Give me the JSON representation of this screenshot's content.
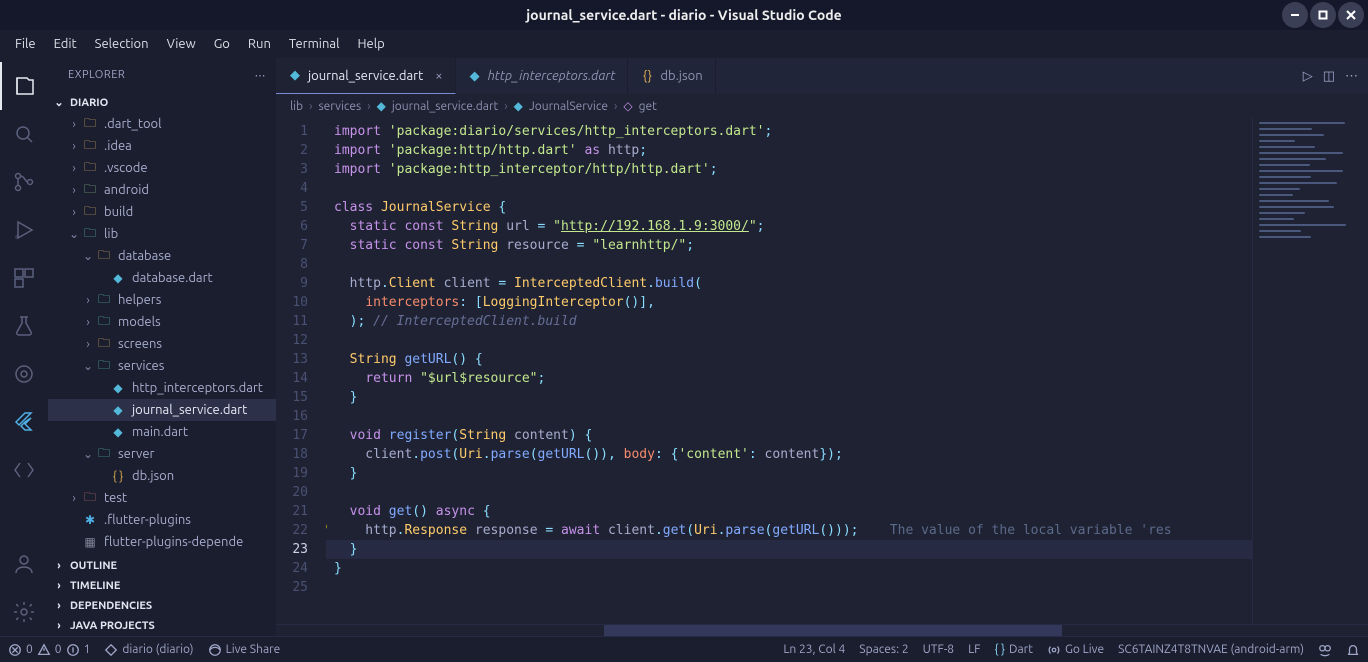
{
  "window": {
    "title": "journal_service.dart - diario - Visual Studio Code"
  },
  "menu": [
    "File",
    "Edit",
    "Selection",
    "View",
    "Go",
    "Run",
    "Terminal",
    "Help"
  ],
  "sidebar": {
    "header": "EXPLORER",
    "project": "DIARIO",
    "tree": [
      {
        "depth": 1,
        "exp": "›",
        "icon": "folder",
        "label": ".dart_tool"
      },
      {
        "depth": 1,
        "exp": "›",
        "icon": "folder",
        "label": ".idea"
      },
      {
        "depth": 1,
        "exp": "›",
        "icon": "folder",
        "label": ".vscode"
      },
      {
        "depth": 1,
        "exp": "›",
        "icon": "folder green",
        "label": "android"
      },
      {
        "depth": 1,
        "exp": "›",
        "icon": "folder",
        "label": "build"
      },
      {
        "depth": 1,
        "exp": "⌄",
        "icon": "folder teal",
        "label": "lib"
      },
      {
        "depth": 2,
        "exp": "⌄",
        "icon": "folder",
        "label": "database"
      },
      {
        "depth": 3,
        "exp": " ",
        "icon": "dart",
        "label": "database.dart"
      },
      {
        "depth": 2,
        "exp": "›",
        "icon": "folder teal",
        "label": "helpers"
      },
      {
        "depth": 2,
        "exp": "›",
        "icon": "folder teal",
        "label": "models"
      },
      {
        "depth": 2,
        "exp": "›",
        "icon": "folder",
        "label": "screens"
      },
      {
        "depth": 2,
        "exp": "⌄",
        "icon": "folder teal",
        "label": "services"
      },
      {
        "depth": 3,
        "exp": " ",
        "icon": "dart",
        "label": "http_interceptors.dart"
      },
      {
        "depth": 3,
        "exp": " ",
        "icon": "dart",
        "label": "journal_service.dart",
        "selected": true
      },
      {
        "depth": 3,
        "exp": " ",
        "icon": "dart",
        "label": "main.dart"
      },
      {
        "depth": 2,
        "exp": "⌄",
        "icon": "folder teal",
        "label": "server"
      },
      {
        "depth": 3,
        "exp": " ",
        "icon": "json",
        "label": "db.json"
      },
      {
        "depth": 1,
        "exp": "›",
        "icon": "folder red",
        "label": "test"
      },
      {
        "depth": 1,
        "exp": " ",
        "icon": "flutter",
        "label": ".flutter-plugins"
      },
      {
        "depth": 1,
        "exp": " ",
        "icon": "misc",
        "label": "flutter-plugins-depende"
      }
    ],
    "sections": [
      {
        "label": "OUTLINE",
        "open": false
      },
      {
        "label": "TIMELINE",
        "open": false
      },
      {
        "label": "DEPENDENCIES",
        "open": false
      },
      {
        "label": "JAVA PROJECTS",
        "open": false
      }
    ]
  },
  "tabs": [
    {
      "icon": "dart",
      "label": "journal_service.dart",
      "active": true,
      "close": true
    },
    {
      "icon": "dart",
      "label": "http_interceptors.dart",
      "italic": true
    },
    {
      "icon": "json",
      "label": "db.json"
    }
  ],
  "breadcrumbs": [
    "lib",
    "services",
    "journal_service.dart",
    "JournalService",
    "get"
  ],
  "code": {
    "numbers": 25,
    "active_line": 23,
    "bulb_line": 22,
    "lines": [
      [
        [
          "c-key",
          "import "
        ],
        [
          "c-str",
          "'package:diario/services/http_interceptors.dart'"
        ],
        [
          "c-punc",
          ";"
        ]
      ],
      [
        [
          "c-key",
          "import "
        ],
        [
          "c-str",
          "'package:http/http.dart'"
        ],
        [
          "c-key",
          " as "
        ],
        [
          "c-ident",
          "http"
        ],
        [
          "c-punc",
          ";"
        ]
      ],
      [
        [
          "c-key",
          "import "
        ],
        [
          "c-str",
          "'package:http_interceptor/http/http.dart'"
        ],
        [
          "c-punc",
          ";"
        ]
      ],
      [],
      [
        [
          "c-key",
          "class "
        ],
        [
          "c-type",
          "JournalService "
        ],
        [
          "c-punc",
          "{"
        ]
      ],
      [
        [
          "c-ident",
          "  "
        ],
        [
          "c-key",
          "static const "
        ],
        [
          "c-type",
          "String "
        ],
        [
          "c-ident",
          "url "
        ],
        [
          "c-punc",
          "= "
        ],
        [
          "c-str",
          "\""
        ],
        [
          "c-link",
          "http://192.168.1.9:3000/"
        ],
        [
          "c-str",
          "\""
        ],
        [
          "c-punc",
          ";"
        ]
      ],
      [
        [
          "c-ident",
          "  "
        ],
        [
          "c-key",
          "static const "
        ],
        [
          "c-type",
          "String "
        ],
        [
          "c-ident",
          "resource "
        ],
        [
          "c-punc",
          "= "
        ],
        [
          "c-str",
          "\"learnhttp/\""
        ],
        [
          "c-punc",
          ";"
        ]
      ],
      [],
      [
        [
          "c-ident",
          "  http"
        ],
        [
          "c-punc",
          "."
        ],
        [
          "c-type",
          "Client "
        ],
        [
          "c-ident",
          "client "
        ],
        [
          "c-punc",
          "= "
        ],
        [
          "c-type",
          "InterceptedClient"
        ],
        [
          "c-punc",
          "."
        ],
        [
          "c-func",
          "build"
        ],
        [
          "c-punc",
          "("
        ]
      ],
      [
        [
          "c-ident",
          "    "
        ],
        [
          "c-param",
          "interceptors"
        ],
        [
          "c-punc",
          ": ["
        ],
        [
          "c-type",
          "LoggingInterceptor"
        ],
        [
          "c-punc",
          "()],"
        ]
      ],
      [
        [
          "c-ident",
          "  "
        ],
        [
          "c-punc",
          "); "
        ],
        [
          "c-comm",
          "// InterceptedClient.build"
        ]
      ],
      [],
      [
        [
          "c-ident",
          "  "
        ],
        [
          "c-type",
          "String "
        ],
        [
          "c-func",
          "getURL"
        ],
        [
          "c-punc",
          "() {"
        ]
      ],
      [
        [
          "c-ident",
          "    "
        ],
        [
          "c-key",
          "return "
        ],
        [
          "c-str",
          "\"$url$resource\""
        ],
        [
          "c-punc",
          ";"
        ]
      ],
      [
        [
          "c-ident",
          "  "
        ],
        [
          "c-punc",
          "}"
        ]
      ],
      [],
      [
        [
          "c-ident",
          "  "
        ],
        [
          "c-key",
          "void "
        ],
        [
          "c-func",
          "register"
        ],
        [
          "c-punc",
          "("
        ],
        [
          "c-type",
          "String "
        ],
        [
          "c-ident",
          "content"
        ],
        [
          "c-punc",
          ") {"
        ]
      ],
      [
        [
          "c-ident",
          "    client"
        ],
        [
          "c-punc",
          "."
        ],
        [
          "c-func",
          "post"
        ],
        [
          "c-punc",
          "("
        ],
        [
          "c-type",
          "Uri"
        ],
        [
          "c-punc",
          "."
        ],
        [
          "c-func",
          "parse"
        ],
        [
          "c-punc",
          "("
        ],
        [
          "c-func",
          "getURL"
        ],
        [
          "c-punc",
          "())"
        ],
        [
          "c-punc",
          ", "
        ],
        [
          "c-param",
          "body"
        ],
        [
          "c-punc",
          ": {"
        ],
        [
          "c-str",
          "'content'"
        ],
        [
          "c-punc",
          ": "
        ],
        [
          "c-ident",
          "content"
        ],
        [
          "c-punc",
          "});"
        ]
      ],
      [
        [
          "c-ident",
          "  "
        ],
        [
          "c-punc",
          "}"
        ]
      ],
      [],
      [
        [
          "c-ident",
          "  "
        ],
        [
          "c-key",
          "void "
        ],
        [
          "c-func",
          "get"
        ],
        [
          "c-punc",
          "() "
        ],
        [
          "c-key",
          "async "
        ],
        [
          "c-punc",
          "{"
        ]
      ],
      [
        [
          "c-ident",
          "    http"
        ],
        [
          "c-punc",
          "."
        ],
        [
          "c-type",
          "Response "
        ],
        [
          "c-ident",
          "response "
        ],
        [
          "c-punc",
          "= "
        ],
        [
          "c-key",
          "await "
        ],
        [
          "c-ident",
          "client"
        ],
        [
          "c-punc",
          "."
        ],
        [
          "c-func",
          "get"
        ],
        [
          "c-punc",
          "("
        ],
        [
          "c-type",
          "Uri"
        ],
        [
          "c-punc",
          "."
        ],
        [
          "c-func",
          "parse"
        ],
        [
          "c-punc",
          "("
        ],
        [
          "c-func",
          "getURL"
        ],
        [
          "c-punc",
          "()));    "
        ],
        [
          "c-warn",
          "The value of the local variable 'res"
        ]
      ],
      [
        [
          "c-ident",
          "  "
        ],
        [
          "c-punc",
          "}"
        ]
      ],
      [
        [
          "c-punc",
          "}"
        ]
      ],
      []
    ]
  },
  "status": {
    "errors": "0",
    "warnings": "0",
    "rc": "1",
    "project": "diario (diario)",
    "liveshare": "Live Share",
    "pos": "Ln 23, Col 4",
    "spaces": "Spaces: 2",
    "enc": "UTF-8",
    "eol": "LF",
    "lang": "Dart",
    "golive": "Go Live",
    "device": "SC6TAINZ4T8TNVAE (android-arm)"
  }
}
